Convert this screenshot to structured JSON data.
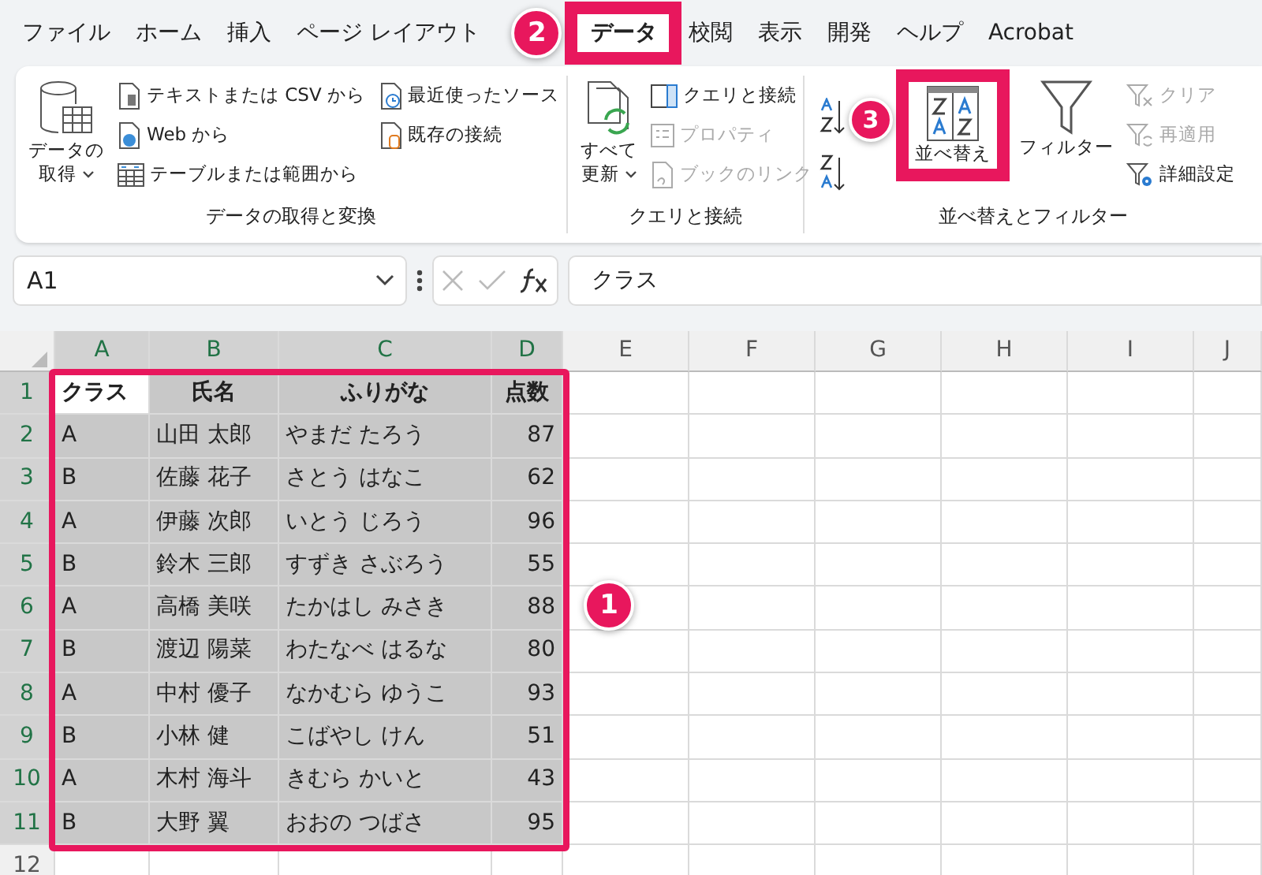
{
  "tabs": [
    {
      "label": "ファイル",
      "selected": false,
      "highlighted": false
    },
    {
      "label": "ホーム",
      "selected": false,
      "highlighted": false
    },
    {
      "label": "挿入",
      "selected": false,
      "highlighted": false
    },
    {
      "label": "ページ レイアウト",
      "selected": false,
      "highlighted": false
    },
    {
      "label": "データ",
      "selected": true,
      "highlighted": true,
      "callout": "2"
    },
    {
      "label": "校閲",
      "selected": false,
      "highlighted": false
    },
    {
      "label": "表示",
      "selected": false,
      "highlighted": false
    },
    {
      "label": "開発",
      "selected": false,
      "highlighted": false
    },
    {
      "label": "ヘルプ",
      "selected": false,
      "highlighted": false
    },
    {
      "label": "Acrobat",
      "selected": false,
      "highlighted": false
    }
  ],
  "ribbon": {
    "groups": [
      {
        "label": "データの取得と変換",
        "items": [
          {
            "kind": "large",
            "lines": [
              "データの",
              "取得"
            ],
            "dropdown": true,
            "highlighted": false,
            "disabled": false
          },
          {
            "kind": "column",
            "items": [
              {
                "label": "テキストまたは CSV から",
                "disabled": false
              },
              {
                "label": "Web から",
                "disabled": false
              },
              {
                "label": "テーブルまたは範囲から",
                "disabled": false
              }
            ]
          },
          {
            "kind": "column",
            "items": [
              {
                "label": "最近使ったソース",
                "disabled": false
              },
              {
                "label": "既存の接続",
                "disabled": false
              }
            ]
          }
        ]
      },
      {
        "label": "クエリと接続",
        "items": [
          {
            "kind": "large",
            "lines": [
              "すべて",
              "更新"
            ],
            "dropdown": true,
            "highlighted": false,
            "disabled": false
          },
          {
            "kind": "column",
            "items": [
              {
                "label": "クエリと接続",
                "disabled": false
              },
              {
                "label": "プロパティ",
                "disabled": true
              },
              {
                "label": "ブックのリンク",
                "disabled": true
              }
            ]
          }
        ]
      },
      {
        "label": "並べ替えとフィルター",
        "items": [
          {
            "kind": "icons"
          },
          {
            "kind": "large",
            "lines": [
              "並べ替え"
            ],
            "dropdown": false,
            "highlighted": true,
            "callout": "3",
            "disabled": false
          },
          {
            "kind": "large",
            "lines": [
              "フィルター"
            ],
            "dropdown": false,
            "highlighted": false,
            "disabled": false
          },
          {
            "kind": "column",
            "items": [
              {
                "label": "クリア",
                "disabled": true
              },
              {
                "label": "再適用",
                "disabled": true
              },
              {
                "label": "詳細設定",
                "disabled": false
              }
            ]
          }
        ]
      }
    ]
  },
  "formula_bar": {
    "name_box": "A1",
    "formula": "クラス"
  },
  "sheet": {
    "columns": [
      {
        "label": "A",
        "selected": true
      },
      {
        "label": "B",
        "selected": true
      },
      {
        "label": "C",
        "selected": true
      },
      {
        "label": "D",
        "selected": true
      },
      {
        "label": "E",
        "selected": false
      },
      {
        "label": "F",
        "selected": false
      },
      {
        "label": "G",
        "selected": false
      },
      {
        "label": "H",
        "selected": false
      },
      {
        "label": "I",
        "selected": false
      },
      {
        "label": "J",
        "selected": false
      }
    ],
    "selection": {
      "highlighted": true,
      "callout": "1"
    },
    "rows": [
      {
        "number": "1",
        "kind": "header",
        "selected": true,
        "cells": [
          "クラス",
          "氏名",
          "ふりがな",
          "点数"
        ]
      },
      {
        "number": "2",
        "kind": "data",
        "selected": true,
        "cells": [
          "A",
          "山田 太郎",
          "やまだ たろう",
          "87"
        ]
      },
      {
        "number": "3",
        "kind": "data",
        "selected": true,
        "cells": [
          "B",
          "佐藤 花子",
          "さとう はなこ",
          "62"
        ]
      },
      {
        "number": "4",
        "kind": "data",
        "selected": true,
        "cells": [
          "A",
          "伊藤 次郎",
          "いとう じろう",
          "96"
        ]
      },
      {
        "number": "5",
        "kind": "data",
        "selected": true,
        "cells": [
          "B",
          "鈴木 三郎",
          "すずき さぶろう",
          "55"
        ]
      },
      {
        "number": "6",
        "kind": "data",
        "selected": true,
        "cells": [
          "A",
          "高橋 美咲",
          "たかはし みさき",
          "88"
        ]
      },
      {
        "number": "7",
        "kind": "data",
        "selected": true,
        "cells": [
          "B",
          "渡辺 陽菜",
          "わたなべ はるな",
          "80"
        ]
      },
      {
        "number": "8",
        "kind": "data",
        "selected": true,
        "cells": [
          "A",
          "中村 優子",
          "なかむら ゆうこ",
          "93"
        ]
      },
      {
        "number": "9",
        "kind": "data",
        "selected": true,
        "cells": [
          "B",
          "小林 健",
          "こばやし けん",
          "51"
        ]
      },
      {
        "number": "10",
        "kind": "data",
        "selected": true,
        "cells": [
          "A",
          "木村 海斗",
          "きむら かいと",
          "43"
        ]
      },
      {
        "number": "11",
        "kind": "data",
        "selected": true,
        "cells": [
          "B",
          "大野 翼",
          "おおの つばさ",
          "95"
        ]
      },
      {
        "number": "12",
        "kind": "data",
        "selected": false,
        "cells": []
      }
    ]
  }
}
